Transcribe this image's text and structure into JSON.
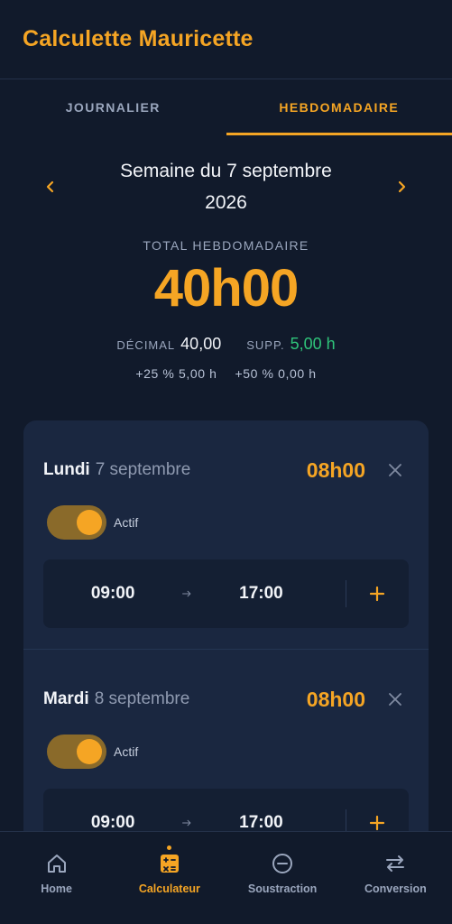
{
  "app": {
    "title": "Calculette Mauricette"
  },
  "tabs": [
    {
      "label": "JOURNALIER"
    },
    {
      "label": "HEBDOMADAIRE"
    }
  ],
  "week": {
    "title_line1": "Semaine du 7 septembre",
    "title_line2": "2026"
  },
  "totals": {
    "label": "TOTAL HEBDOMADAIRE",
    "value": "40h00",
    "decimal_label": "DÉCIMAL",
    "decimal_value": "40,00",
    "supp_label": "SUPP.",
    "supp_value": "5,00 h",
    "plus25": "+25 % 5,00 h",
    "plus50": "+50 % 0,00 h"
  },
  "days": [
    {
      "name": "Lundi",
      "date": "7 septembre",
      "hours": "08h00",
      "toggle_label": "Actif",
      "start": "09:00",
      "end": "17:00"
    },
    {
      "name": "Mardi",
      "date": "8 septembre",
      "hours": "08h00",
      "toggle_label": "Actif",
      "start": "09:00",
      "end": "17:00"
    }
  ],
  "nav": [
    {
      "label": "Home",
      "icon": "home-icon"
    },
    {
      "label": "Calculateur",
      "icon": "calculator-icon"
    },
    {
      "label": "Soustraction",
      "icon": "minus-circle-icon"
    },
    {
      "label": "Conversion",
      "icon": "swap-arrows-icon"
    }
  ],
  "colors": {
    "accent": "#f5a524",
    "background": "#111a2b",
    "card": "#1a2740",
    "positive": "#2fc47a"
  }
}
